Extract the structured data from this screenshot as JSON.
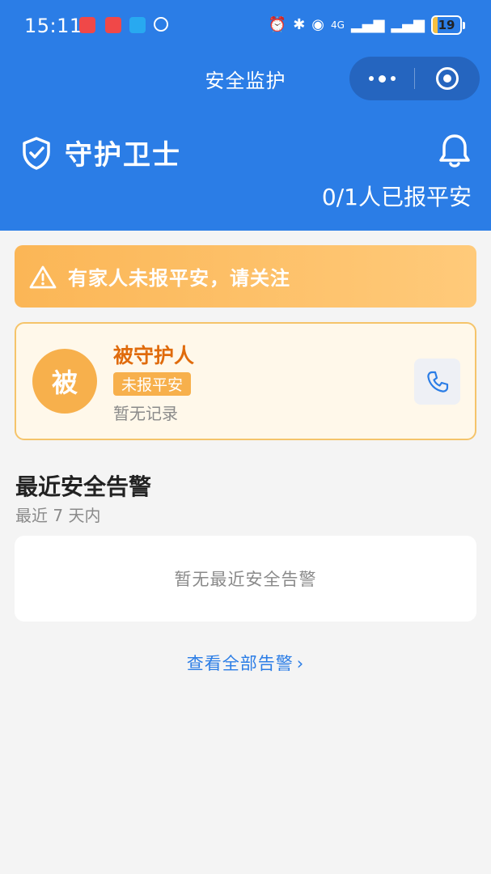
{
  "status_bar": {
    "time": "15:11",
    "network": "4G",
    "battery": "19",
    "battery_level": 0.19
  },
  "nav": {
    "title": "安全监护"
  },
  "header": {
    "app_title": "守护卫士",
    "report_summary": "0/1人已报平安"
  },
  "alert_banner": {
    "text": "有家人未报平安，请关注"
  },
  "protected_person": {
    "avatar_char": "被",
    "name": "被守护人",
    "status": "未报平安",
    "record": "暂无记录"
  },
  "recent_alerts": {
    "title": "最近安全告警",
    "subtitle": "最近 7 天内",
    "empty_text": "暂无最近安全告警",
    "view_all": "查看全部告警",
    "view_all_chevron": "›"
  },
  "colors": {
    "header_bg": "#2b7de6",
    "banner": "#fbb656",
    "status_badge": "#f7b04c",
    "person_name": "#e06b0c",
    "link": "#2b7de6"
  }
}
